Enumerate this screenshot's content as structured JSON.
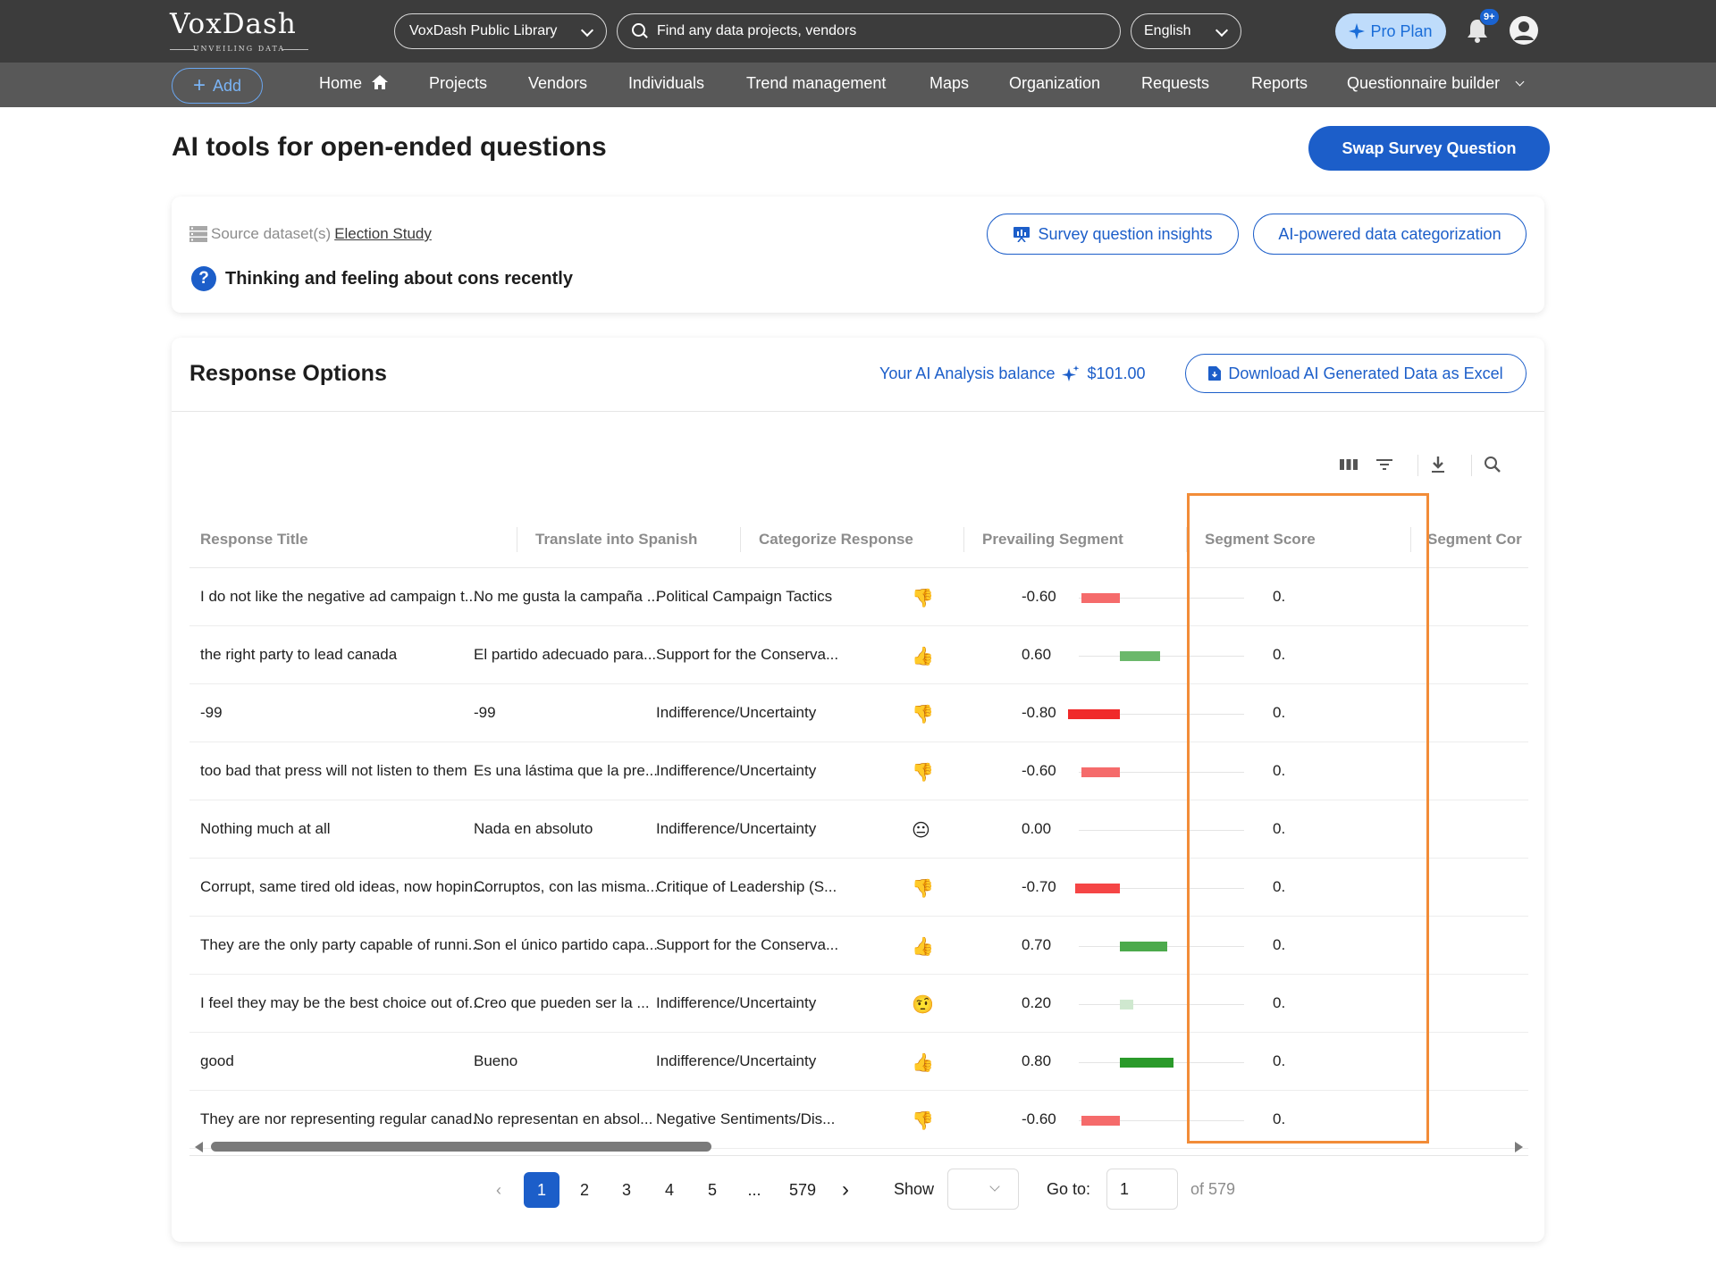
{
  "header": {
    "logo_word": "VoxDash",
    "logo_tagline": "UNVEILING DATA",
    "library_select": "VoxDash Public Library",
    "search_placeholder": "Find any data projects, vendors",
    "language": "English",
    "pro_plan": "Pro Plan",
    "notification_badge": "9+"
  },
  "nav": {
    "add": "Add",
    "items": [
      "Home",
      "Projects",
      "Vendors",
      "Individuals",
      "Trend management",
      "Maps",
      "Organization",
      "Requests",
      "Reports",
      "Questionnaire builder"
    ]
  },
  "page": {
    "title": "AI tools for open-ended questions",
    "swap_button": "Swap Survey Question"
  },
  "source": {
    "label": "Source dataset(s)",
    "dataset": "Election Study",
    "question": "Thinking and feeling about cons recently",
    "insights_button": "Survey question insights",
    "categorization_button": "AI-powered data categorization"
  },
  "responses": {
    "title": "Response Options",
    "balance_label": "Your AI Analysis balance",
    "balance_value": "$101.00",
    "download_button": "Download AI Generated Data as Excel",
    "columns": [
      "Response Title",
      "Translate into Spanish",
      "Categorize Response",
      "Prevailing Segment",
      "Segment Score",
      "Segment Cor"
    ],
    "rows": [
      {
        "title": "I do not like the negative ad campaign t...",
        "spanish": "No me gusta la campaña ...",
        "category": "Political Campaign Tactics",
        "segment": "👎",
        "score": "-0.60",
        "score_value": -0.6,
        "bar_color": "#f56b6b",
        "corr": "0."
      },
      {
        "title": "the right party to lead canada",
        "spanish": "El partido adecuado para...",
        "category": "Support for the Conserva...",
        "segment": "👍",
        "score": "0.60",
        "score_value": 0.6,
        "bar_color": "#6bb86b",
        "corr": "0."
      },
      {
        "title": "-99",
        "spanish": "-99",
        "category": "Indifference/Uncertainty",
        "segment": "👎",
        "score": "-0.80",
        "score_value": -0.8,
        "bar_color": "#f02a2a",
        "corr": "0."
      },
      {
        "title": "too bad that press will not listen to them",
        "spanish": "Es una lástima que la pre...",
        "category": "Indifference/Uncertainty",
        "segment": "👎",
        "score": "-0.60",
        "score_value": -0.6,
        "bar_color": "#f56b6b",
        "corr": "0."
      },
      {
        "title": "Nothing much at all",
        "spanish": "Nada en absoluto",
        "category": "Indifference/Uncertainty",
        "segment": "😐",
        "score": "0.00",
        "score_value": 0,
        "bar_color": "#cccccc",
        "corr": "0."
      },
      {
        "title": "Corrupt, same tired old ideas, now hopin...",
        "spanish": "Corruptos, con las misma...",
        "category": "Critique of Leadership (S...",
        "segment": "👎",
        "score": "-0.70",
        "score_value": -0.7,
        "bar_color": "#f54545",
        "corr": "0."
      },
      {
        "title": "They are the only party capable of runni...",
        "spanish": "Son el único partido capa...",
        "category": "Support for the Conserva...",
        "segment": "👍",
        "score": "0.70",
        "score_value": 0.7,
        "bar_color": "#4caa4c",
        "corr": "0."
      },
      {
        "title": "I feel they may be the best choice out of...",
        "spanish": "Creo que pueden ser la ...",
        "category": "Indifference/Uncertainty",
        "segment": "🤨",
        "score": "0.20",
        "score_value": 0.2,
        "bar_color": "#cfe8cf",
        "corr": "0."
      },
      {
        "title": "good",
        "spanish": "Bueno",
        "category": "Indifference/Uncertainty",
        "segment": "👍",
        "score": "0.80",
        "score_value": 0.8,
        "bar_color": "#2a9a2a",
        "corr": "0."
      },
      {
        "title": "They are nor representing regular canad...",
        "spanish": "No representan en absol...",
        "category": "Negative Sentiments/Dis...",
        "segment": "👎",
        "score": "-0.60",
        "score_value": -0.6,
        "bar_color": "#f56b6b",
        "corr": "0."
      }
    ]
  },
  "pagination": {
    "pages": [
      "1",
      "2",
      "3",
      "4",
      "5",
      "...",
      "579"
    ],
    "show_label": "Show",
    "goto_label": "Go to:",
    "goto_value": "1",
    "of_total": "of 579"
  },
  "colors": {
    "brand_blue": "#1c5ec9",
    "highlight": "#f28c38",
    "topbar": "#3c3c3c",
    "navbar": "#585858"
  }
}
